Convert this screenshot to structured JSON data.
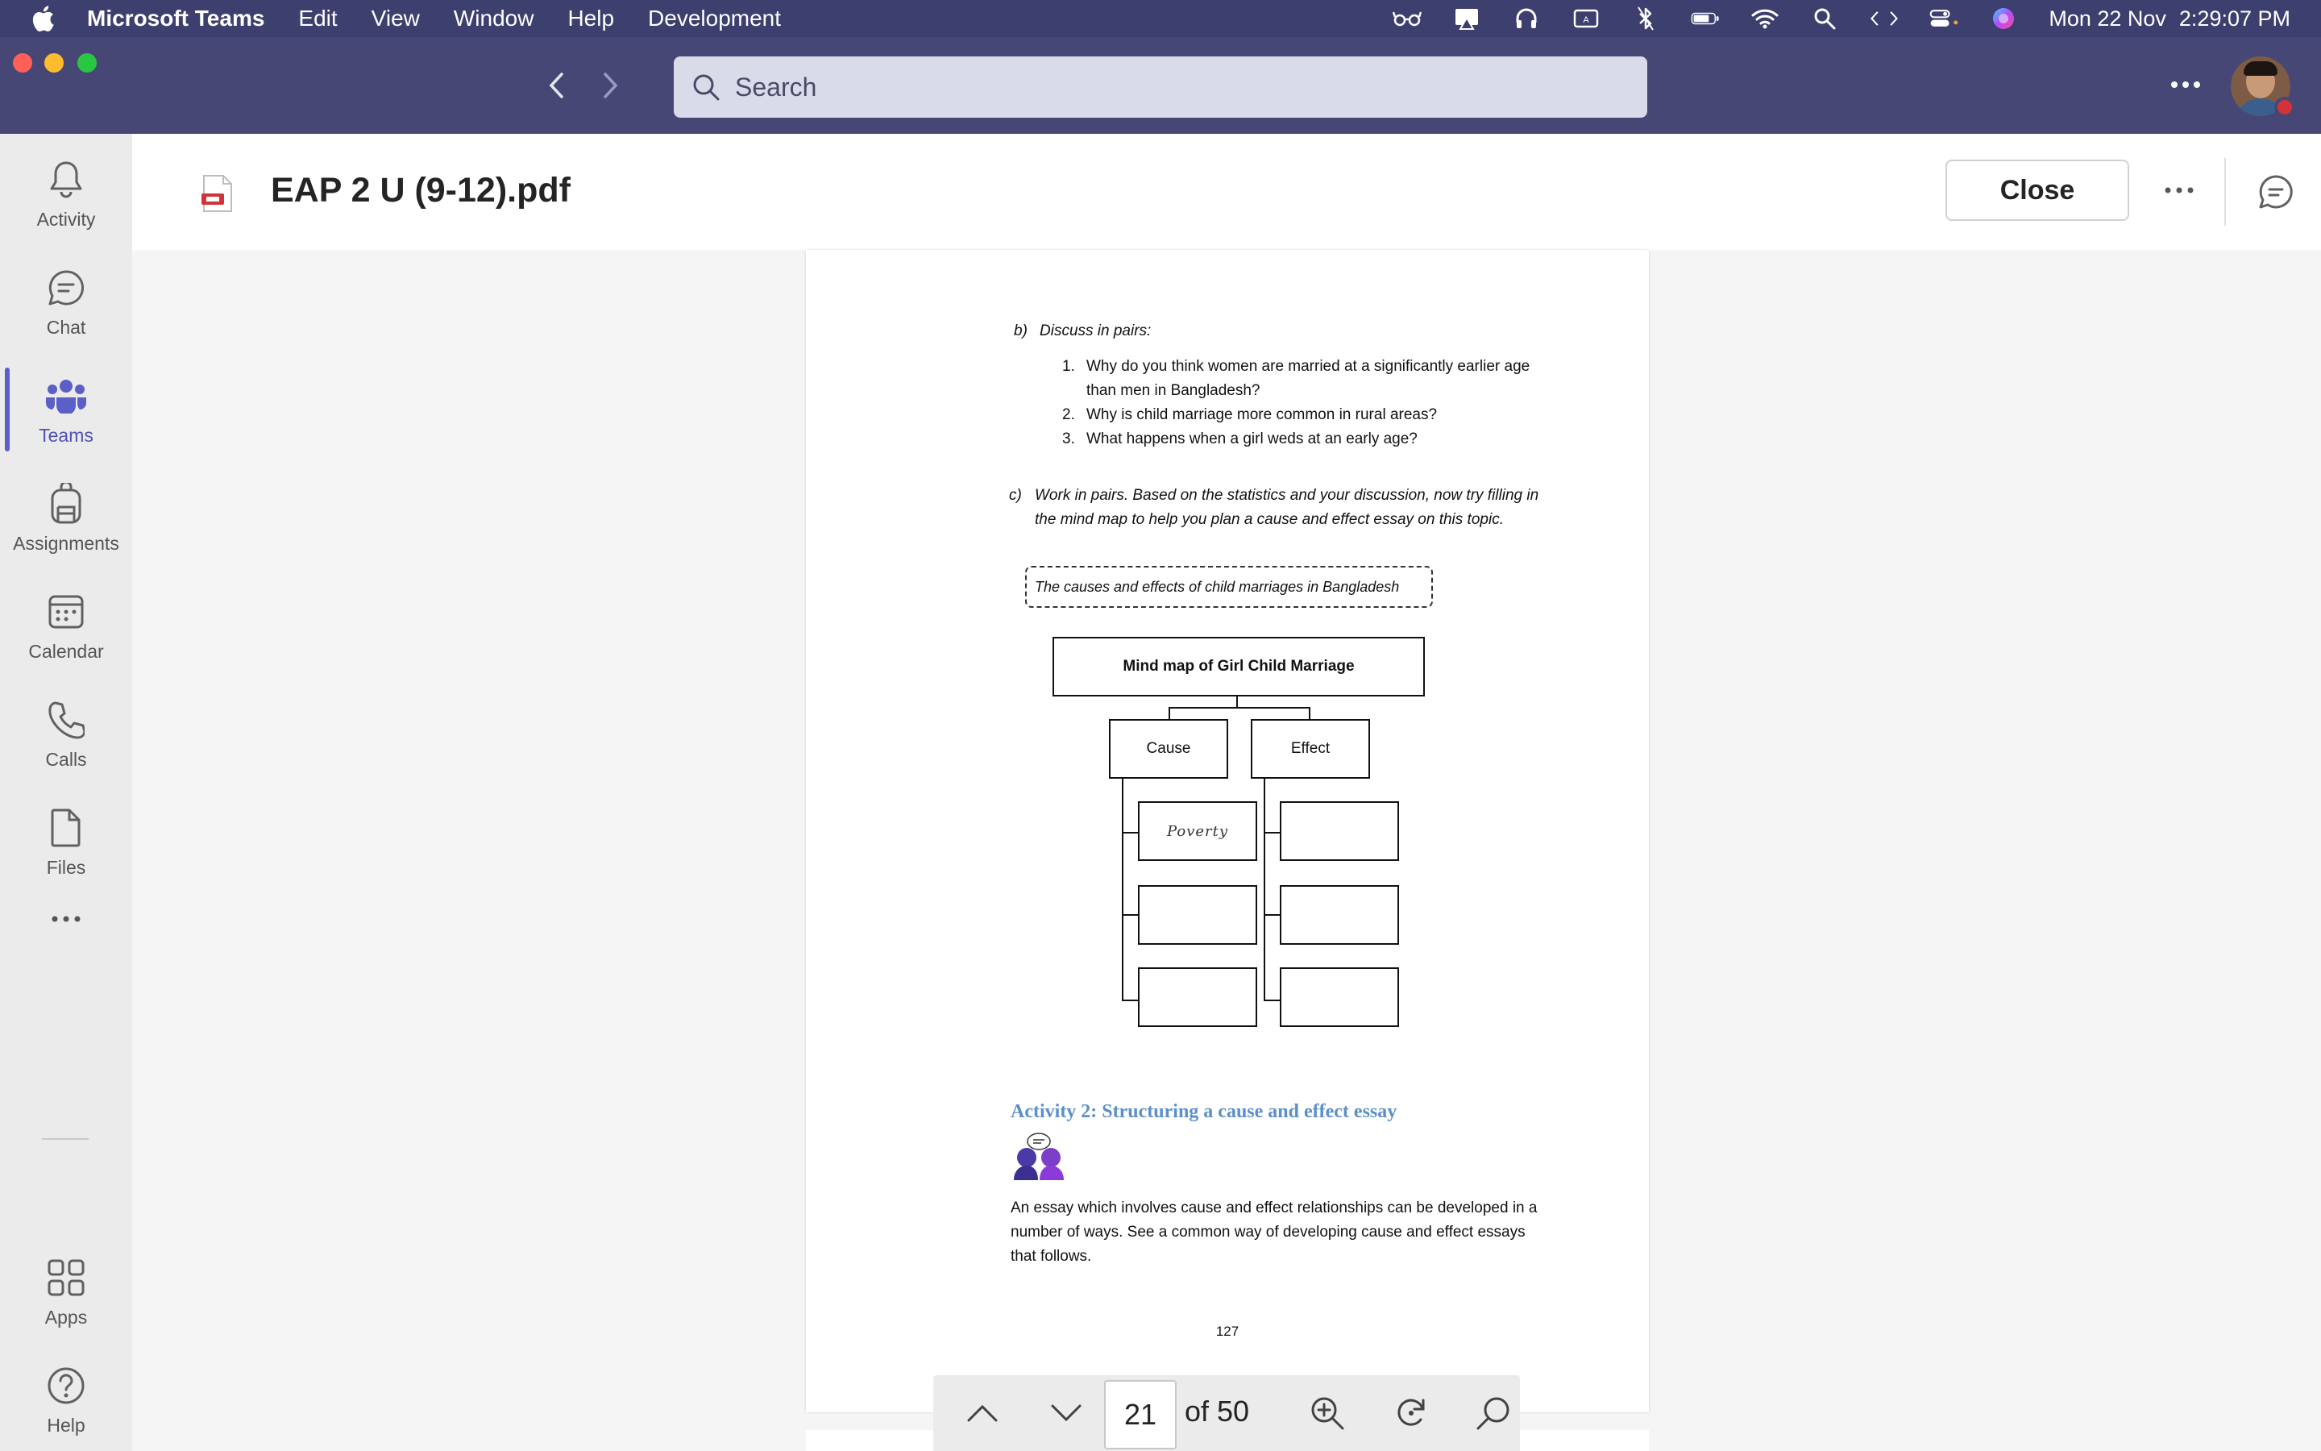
{
  "menubar": {
    "app_name": "Microsoft Teams",
    "items": [
      "Edit",
      "View",
      "Window",
      "Help",
      "Development"
    ],
    "date": "Mon 22 Nov",
    "time": "2:29:07 PM"
  },
  "titlebar": {
    "search_placeholder": "Search"
  },
  "rail": {
    "items": [
      {
        "label": "Activity",
        "icon": "bell-icon"
      },
      {
        "label": "Chat",
        "icon": "chat-icon"
      },
      {
        "label": "Teams",
        "icon": "teams-icon",
        "active": true
      },
      {
        "label": "Assignments",
        "icon": "backpack-icon"
      },
      {
        "label": "Calendar",
        "icon": "calendar-icon"
      },
      {
        "label": "Calls",
        "icon": "phone-icon"
      },
      {
        "label": "Files",
        "icon": "file-icon"
      }
    ],
    "bottom": [
      {
        "label": "Apps",
        "icon": "apps-icon"
      },
      {
        "label": "Help",
        "icon": "help-icon"
      }
    ]
  },
  "doc": {
    "title": "EAP 2 U (9-12).pdf",
    "close_label": "Close"
  },
  "pdf_page": {
    "b_label": "b)",
    "b_text": "Discuss in pairs:",
    "questions": [
      {
        "num": "1.",
        "line1": "Why do you think women are married at a significantly earlier age",
        "line2": "than men in Bangladesh?"
      },
      {
        "num": "2.",
        "line1": "Why is child marriage more common in rural areas?"
      },
      {
        "num": "3.",
        "line1": "What happens when a girl weds at an early age?"
      }
    ],
    "c_label": "c)",
    "c_line1": "Work in pairs. Based on the statistics and your discussion, now try filling in",
    "c_line2": "the mind map to help you plan a cause and effect essay on this topic.",
    "topic_box": "The causes and effects of child marriages in Bangladesh",
    "mind_map": {
      "title": "Mind map of Girl Child Marriage",
      "cause": "Cause",
      "effect": "Effect",
      "cause_items": [
        "Poverty",
        "",
        ""
      ],
      "effect_items": [
        "",
        "",
        ""
      ]
    },
    "activity_heading": "Activity 2: Structuring a cause and effect essay",
    "body_lines": [
      "An essay which involves cause and effect relationships can be developed in a",
      "number of ways. See a common way of developing cause and effect essays",
      "that follows."
    ],
    "page_number": "127"
  },
  "pdf_toolbar": {
    "current_page": "21",
    "of_total": "of 50"
  },
  "colors": {
    "titlebar": "#464775",
    "accent": "#5b5fc7",
    "activity_heading": "#5b8fc9"
  }
}
